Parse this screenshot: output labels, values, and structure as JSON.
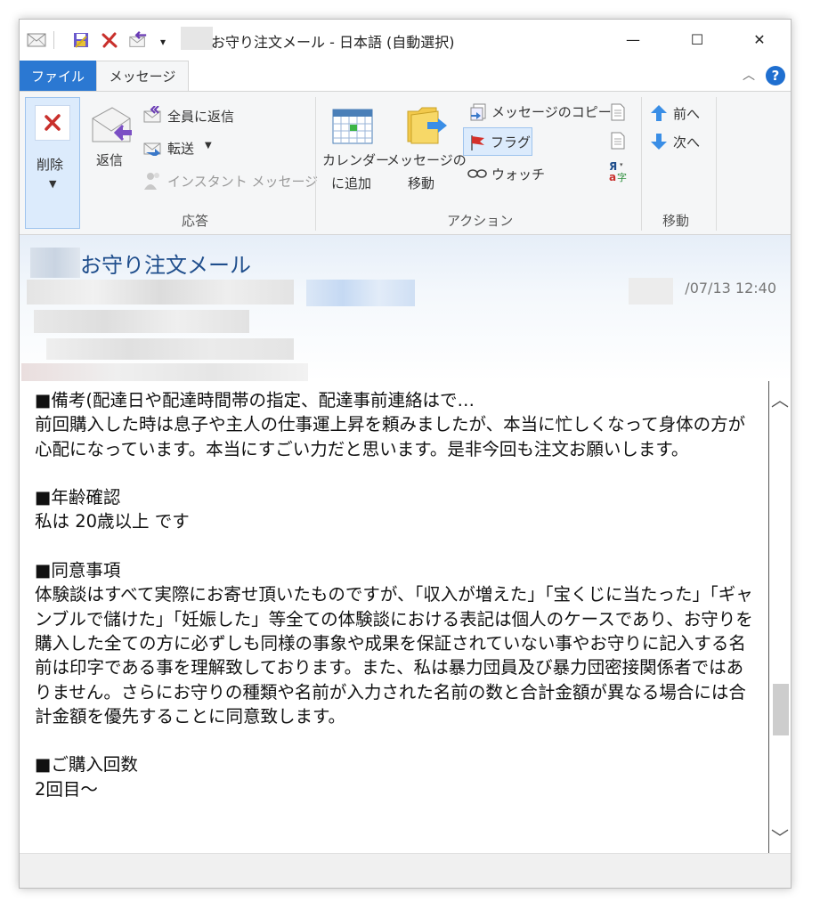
{
  "window": {
    "title": "お守り注文メール - 日本語 (自動選択)",
    "minimize_glyph": "—",
    "maximize_glyph": "☐",
    "close_glyph": "✕"
  },
  "tabs": {
    "file": "ファイル",
    "message": "メッセージ"
  },
  "ribbon": {
    "delete": "削除",
    "reply": "返信",
    "reply_all": "全員に返信",
    "forward": "転送",
    "instant_message": "インスタント メッセージ",
    "calendar_line1": "カレンダー",
    "calendar_line2": "に追加",
    "move_line1": "メッセージの",
    "move_line2": "移動",
    "copy_message": "メッセージのコピー",
    "flag": "フラグ",
    "watch": "ウォッチ",
    "prev": "前へ",
    "next": "次へ",
    "group_respond": "応答",
    "group_actions": "アクション",
    "group_move": "移動"
  },
  "header": {
    "subject": "お守り注文メール",
    "date": "/07/13 12:40"
  },
  "body": {
    "text": "■備考(配達日や配達時間帯の指定、配達事前連絡はで…\n前回購入した時は息子や主人の仕事運上昇を頼みましたが、本当に忙しくなって身体の方が心配になっています。本当にすごい力だと思います。是非今回も注文お願いします。\n\n■年齢確認\n私は 20歳以上 です\n\n■同意事項\n体験談はすべて実際にお寄せ頂いたものですが、「収入が増えた」「宝くじに当たった」「ギャンブルで儲けた」「妊娠した」等全ての体験談における表記は個人のケースであり、お守りを購入した全ての方に必ずしも同様の事象や成果を保証されていない事やお守りに記入する名前は印字である事を理解致しております。また、私は暴力団員及び暴力団密接関係者ではありません。さらにお守りの種類や名前が入力された名前の数と合計金額が異なる場合には合計金額を優先することに同意致します。\n\n■ご購入回数\n2回目～"
  },
  "colors": {
    "accent": "#2b78d2",
    "subject": "#1f4e8c",
    "ribbon_bg": "#f5f6f7"
  }
}
